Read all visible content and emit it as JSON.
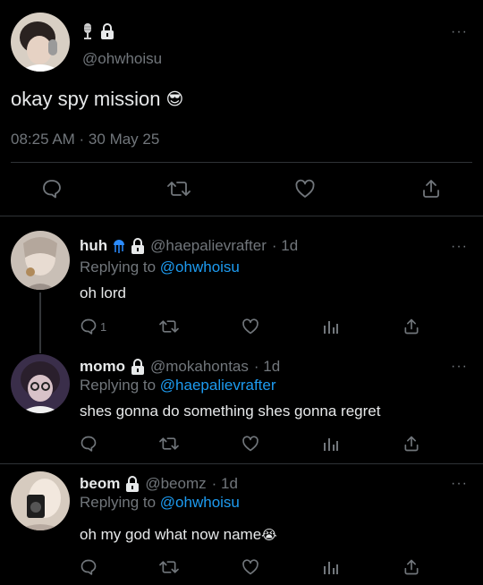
{
  "main_tweet": {
    "handle": "@ohwhoisu",
    "text": "okay spy mission",
    "text_emoji": "😎",
    "timestamp": "08:25 AM · 30 May 25",
    "icons": [
      "microphone-icon",
      "lock-icon"
    ]
  },
  "actions": {
    "reply_icon": "reply-icon",
    "retweet_icon": "retweet-icon",
    "like_icon": "like-icon",
    "share_icon": "share-icon",
    "analytics_icon": "analytics-icon"
  },
  "replies": [
    {
      "name": "huh",
      "handle": "@haepalievrafter",
      "time": "· 1d",
      "replying_prefix": "Replying to",
      "replying_handle": "@ohwhoisu",
      "text": "oh lord",
      "reply_count": "1"
    },
    {
      "name": "momo",
      "handle": "@mokahontas",
      "time": "· 1d",
      "replying_prefix": "Replying to",
      "replying_handle": "@haepalievrafter",
      "text": "shes gonna do something shes gonna regret",
      "reply_count": ""
    },
    {
      "name": "beom",
      "handle": "@beomz",
      "time": "· 1d",
      "replying_prefix": "Replying to",
      "replying_handle": "@ohwhoisu",
      "text": "oh my god what now name",
      "text_emoji": "😭",
      "reply_count": ""
    }
  ],
  "more_label": "···",
  "colors": {
    "background": "#000000",
    "text": "#e7e9ea",
    "muted": "#71767b",
    "link": "#1d9bf0",
    "divider": "#2f3336"
  }
}
